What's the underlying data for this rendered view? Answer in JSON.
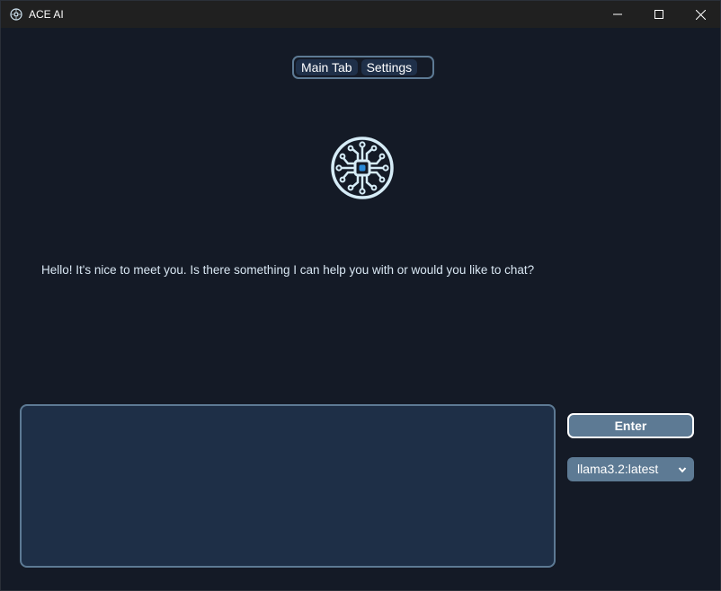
{
  "window": {
    "title": "ACE AI",
    "app_icon": "circuit-globe-icon",
    "controls": [
      "minimize-icon",
      "maximize-icon",
      "close-icon"
    ]
  },
  "tabs": [
    {
      "label": "Main Tab",
      "active": true
    },
    {
      "label": "Settings",
      "active": false
    }
  ],
  "logo": {
    "icon": "circuit-chip-icon",
    "accent": "#2a8ad8",
    "stroke": "#d6ecf7"
  },
  "chat": {
    "message": "Hello! It's nice to meet you. Is there something I can help you with or would you like to chat?"
  },
  "input": {
    "value": "",
    "placeholder": ""
  },
  "enter_button": {
    "label": "Enter"
  },
  "model_select": {
    "selected": "llama3.2:latest",
    "icon": "chevron-down-icon"
  },
  "colors": {
    "background": "#141a26",
    "panel": "#1e2f47",
    "accent": "#5d7a94",
    "text": "#d8e6f2"
  }
}
